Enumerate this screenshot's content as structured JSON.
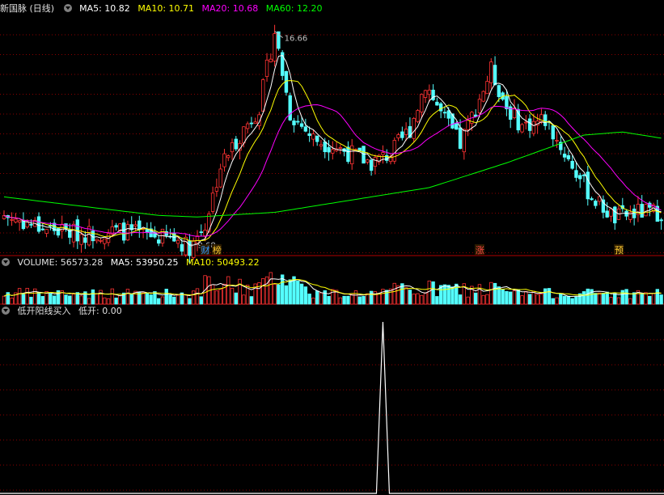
{
  "price_panel": {
    "title": "新国脉 (日线)",
    "ma_labels": [
      {
        "text": "MA5: 10.82",
        "color": "#ffffff"
      },
      {
        "text": "MA10: 10.71",
        "color": "#ffff00"
      },
      {
        "text": "MA20: 10.68",
        "color": "#ff00ff"
      },
      {
        "text": "MA60: 12.20",
        "color": "#00ff00"
      }
    ],
    "high_label": "16.66",
    "low_label": "9.68",
    "markers": [
      {
        "text": "财",
        "color": "#3399ff",
        "index": 52
      },
      {
        "text": "榜",
        "color": "#ffcc33",
        "index": 55
      },
      {
        "text": "涨",
        "color": "#ff4444",
        "index": 123
      },
      {
        "text": "预",
        "color": "#ffcc33",
        "index": 159
      }
    ]
  },
  "volume_panel": {
    "title": "VOLUME: 56573.28",
    "ma_labels": [
      {
        "text": "MA5: 53950.25",
        "color": "#ffffff"
      },
      {
        "text": "MA10: 50493.22",
        "color": "#ffff00"
      }
    ]
  },
  "indicator_panel": {
    "title": "低开阳线买入",
    "value_label": "低开: 0.00"
  },
  "colors": {
    "up": "#ff3333",
    "down": "#54ffff",
    "ma5": "#ffffff",
    "ma10": "#ffff00",
    "ma20": "#ff00ff",
    "ma60": "#00ff00",
    "grid": "#8b0000"
  },
  "chart_data": {
    "type": "candlestick",
    "ohlc_anchors": [
      [
        0,
        10.7
      ],
      [
        10,
        10.3
      ],
      [
        20,
        10.1
      ],
      [
        30,
        10.2
      ],
      [
        40,
        10.0
      ],
      [
        45,
        9.9
      ],
      [
        48,
        9.68
      ],
      [
        52,
        10.4
      ],
      [
        56,
        12.3
      ],
      [
        62,
        13.5
      ],
      [
        66,
        14.2
      ],
      [
        70,
        16.66
      ],
      [
        74,
        14.0
      ],
      [
        80,
        13.2
      ],
      [
        88,
        12.8
      ],
      [
        95,
        12.4
      ],
      [
        100,
        12.7
      ],
      [
        105,
        13.5
      ],
      [
        109,
        15.0
      ],
      [
        113,
        14.0
      ],
      [
        118,
        13.0
      ],
      [
        122,
        14.2
      ],
      [
        126,
        15.4
      ],
      [
        130,
        14.2
      ],
      [
        134,
        13.6
      ],
      [
        140,
        13.8
      ],
      [
        146,
        12.5
      ],
      [
        152,
        11.3
      ],
      [
        158,
        10.6
      ],
      [
        164,
        10.8
      ],
      [
        170,
        10.8
      ]
    ],
    "price_ylim": [
      9.4,
      17.2
    ],
    "ma60_anchors": [
      [
        0,
        11.3
      ],
      [
        20,
        11.0
      ],
      [
        40,
        10.7
      ],
      [
        50,
        10.65
      ],
      [
        70,
        10.8
      ],
      [
        90,
        11.2
      ],
      [
        110,
        11.6
      ],
      [
        130,
        12.4
      ],
      [
        150,
        13.3
      ],
      [
        160,
        13.4
      ],
      [
        170,
        13.2
      ]
    ],
    "volume_ylim": [
      0,
      80000
    ],
    "indicator_spike_index": 98,
    "indicator_ylim": [
      0,
      1
    ]
  }
}
